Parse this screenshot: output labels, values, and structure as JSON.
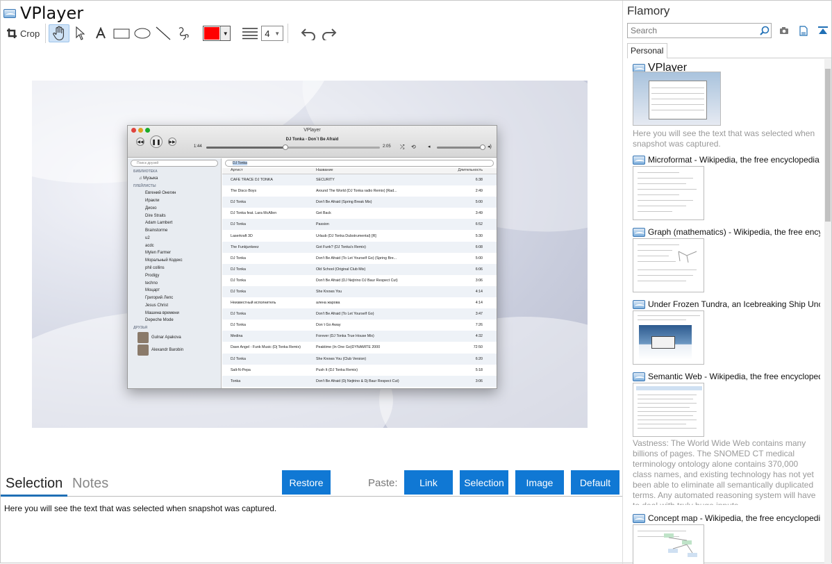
{
  "window": {
    "title": "VPlayer"
  },
  "toolbar": {
    "crop_label": "Crop",
    "line_width": "4",
    "color": "#ff0000"
  },
  "player": {
    "title": "VPlayer",
    "now_playing": "DJ Tonka - Don`t Be Afraid",
    "elapsed": "1:44",
    "total": "2:05",
    "sidebar_search": "Поиск друзей",
    "library_header": "БИБЛИОТЕКА",
    "music": "Музыка",
    "playlists_header": "ПЛЕЙЛИСТЫ",
    "playlists": [
      "Евгений Онегин",
      "Иракли",
      "Диско",
      "Dire Straits",
      "Adam Lambert",
      "Brainstorme",
      "u2",
      "acdc",
      "Mylen Farmer",
      "Моральный Кодекс",
      "phil collins",
      "Prodigy",
      "techno",
      "Моцарт",
      "Григорий Лепс",
      "Jesus Christ",
      "Машина времени",
      "Depeche Mode"
    ],
    "friends_header": "ДРУЗЬЯ",
    "friends": [
      "Gulnar Apakova",
      "Alexandr Barobin"
    ],
    "search_value": "DJ Tonka",
    "columns": [
      "Артист",
      "Название",
      "Длительность"
    ],
    "tracks": [
      [
        "CAFE TRACE DJ TONKA",
        "SECURITY",
        "6:38"
      ],
      [
        "The Disco Boys",
        "Around The World (DJ Tonka radio Remix) [Rad...",
        "2:49"
      ],
      [
        "DJ Tonka",
        "Don't Be Afraid (Spring Break Mix)",
        "5:00"
      ],
      [
        "DJ Tonka feat. Lara McAllen",
        "Get Back",
        "3:49"
      ],
      [
        "DJ Tonka",
        "Passion",
        "6:52"
      ],
      [
        "Laserkraft 3D",
        "Urlaub (DJ Tonka Dubstrumental) [R]",
        "5:30"
      ],
      [
        "The Funkjunkeez",
        "Got Funk? (DJ Tonka's Remix)",
        "6:08"
      ],
      [
        "DJ Tonka",
        "Don't Be Afraid (To Let Yourself Go) (Spring Bre...",
        "5:00"
      ],
      [
        "DJ Tonka",
        "Old School (Original Club Mix)",
        "6:06"
      ],
      [
        "DJ Tonka",
        "Don't Be Afraid (DJ Nejtrino DJ Baur Respect Cut)",
        "3:06"
      ],
      [
        "DJ Tonka",
        "She Knows You",
        "4:14"
      ],
      [
        "Неизвестный исполнитель",
        "алена жарова",
        "4:14"
      ],
      [
        "DJ Tonka",
        "Don't Be Afraid (To Let Yourself Go)",
        "3:47"
      ],
      [
        "DJ Tonka",
        "Don`t Go Away",
        "7:26"
      ],
      [
        "Medina",
        "Forever (DJ Tonka True House Mix)",
        "4:32"
      ],
      [
        "Dave Angel - Funk Music (Dj Tonka Remix)",
        "Peaktime (In One Go)DYNAMITE 2000",
        "72:50"
      ],
      [
        "DJ Tonka",
        "She Knows You (Club Version)",
        "6:20"
      ],
      [
        "Salt-N-Pepa",
        "Push It (DJ Tonka Remix)",
        "5:18"
      ],
      [
        "Tonka",
        "Don't Be Afraid (Dj Nejtrino & Dj Baur Respect Cut)",
        "3:06"
      ]
    ]
  },
  "bottom": {
    "tab_selection": "Selection",
    "tab_notes": "Notes",
    "restore": "Restore",
    "paste_label": "Paste:",
    "link": "Link",
    "selection": "Selection",
    "image": "Image",
    "default": "Default",
    "note_text": "Here you will see the text that was selected when snapshot was captured."
  },
  "flamory": {
    "title": "Flamory",
    "search_placeholder": "Search",
    "tab": "Personal",
    "items": [
      {
        "title": "VPlayer",
        "desc": "Here you will see the text that was selected when snapshot was captured."
      },
      {
        "title": "Microformat - Wikipedia, the free encyclopedia"
      },
      {
        "title": "Graph (mathematics) - Wikipedia, the free ency"
      },
      {
        "title": "Under Frozen Tundra, an Icebreaking Ship Unco"
      },
      {
        "title": "Semantic Web - Wikipedia, the free encycloped",
        "desc": "Vastness: The World Wide Web contains many billions of pages. The SNOMED CT medical terminology ontology alone contains 370,000 class names, and existing technology has not yet been able to eliminate all semantically duplicated terms. Any automated reasoning system will have to deal with truly huge inputs."
      },
      {
        "title": "Concept map - Wikipedia, the free encyclopedi"
      }
    ]
  }
}
